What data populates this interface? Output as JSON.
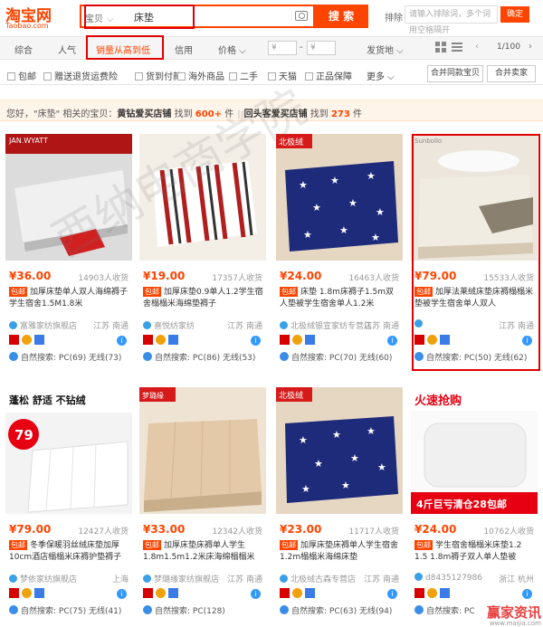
{
  "header": {
    "logo_cn": "淘宝网",
    "logo_en": "Taobao.com",
    "search_category": "宝贝",
    "search_query": "床垫",
    "search_button": "搜 索",
    "sort_label": "排除",
    "sort_placeholder": "请输入排除词，多个词用空格隔开",
    "sort_button": "确定"
  },
  "sortbar": {
    "items": [
      "综合",
      "人气",
      "销量从高到低",
      "信用",
      "价格"
    ],
    "price_from": "¥",
    "price_to": "¥",
    "ship_from": "发货地",
    "page": "1/100"
  },
  "filters": {
    "items": [
      "包邮",
      "赠送退货运费险",
      "货到付款",
      "海外商品",
      "二手",
      "天猫",
      "正品保障"
    ],
    "more": "更多",
    "merge_same": "合并同款宝贝",
    "merge_seller": "合并卖家"
  },
  "infobar": {
    "prefix": "您好，\"床垫\" 相关的宝贝：",
    "store1": "黄钻爱买店铺",
    "found1": "找到",
    "count1": "600+",
    "unit1": "件",
    "store2": "回头客爱买店铺",
    "found2": "找到",
    "count2": "273",
    "unit2": "件"
  },
  "products": [
    {
      "thumb_label": "JAN.WYATT",
      "price": "¥36.00",
      "buyers": "14903人收货",
      "title": "加厚床垫单人双人海绵褥子学生宿舍1.5M1.8米",
      "shop": "富雅家纺旗舰店",
      "loc": "江苏 南通",
      "natural": "自然搜索: PC(69) 无线(73)"
    },
    {
      "thumb_label": "",
      "price": "¥19.00",
      "buyers": "17357人收货",
      "title": "加厚床垫0.9单人1.2学生宿舍榻榻米海绵垫褥子",
      "shop": "喜悦纺家纺",
      "loc": "江苏 南通",
      "natural": "自然搜索: PC(86) 无线(53)"
    },
    {
      "thumb_label": "北极绒",
      "price": "¥24.00",
      "buyers": "16463人收货",
      "title": "床垫 1.8m床褥子1.5m双人垫被学生宿舍单人1.2米",
      "shop": "北极绒银宣家纺专营店",
      "loc": "江苏 南通",
      "natural": "自然搜索: PC(70) 无线(60)"
    },
    {
      "thumb_label": "Sunbollo",
      "price": "¥79.00",
      "buyers": "15533人收货",
      "title": "加厚法莱绒床垫床褥榻榻米垫被学生宿舍单人双人",
      "shop": "",
      "loc": "江苏 南通",
      "natural": "自然搜索: PC(50) 无线(62)"
    },
    {
      "thumb_label": "79",
      "price": "¥79.00",
      "buyers": "12427人收货",
      "title": "冬季保暖羽丝绒床垫加厚10cm酒店榻榻米床褥护垫褥子",
      "shop": "梦依家纺旗舰店",
      "loc": "上海",
      "natural": "自然搜索: PC(75) 无线(41)"
    },
    {
      "thumb_label": "梦璐缘",
      "price": "¥33.00",
      "buyers": "12342人收货",
      "title": "加厚床垫床褥单人学生1.8m1.5m1.2米床海绵榻榻米",
      "shop": "梦璐缘家纺旗舰店",
      "loc": "江苏 南通",
      "natural": "自然搜索: PC(128)"
    },
    {
      "thumb_label": "北极绒",
      "price": "¥23.00",
      "buyers": "11717人收货",
      "title": "加厚床垫床褥单人学生宿舍1.2m榻榻米海绵床垫",
      "shop": "北极绒古森专营店",
      "loc": "江苏 南通",
      "natural": "自然搜索: PC(63) 无线(94)"
    },
    {
      "thumb_label": "火速抢购",
      "price": "¥24.00",
      "buyers": "10762人收货",
      "title": "学生宿舍榻榻米床垫1.2 1.5 1.8m褥子双人单人垫被",
      "shop": "d8435127986",
      "loc": "浙江 杭州",
      "natural": "自然搜索: PC"
    }
  ],
  "watermark": "西纳电商学院",
  "corner_wm": "赢家资讯",
  "corner_wm_url": "www.maijia.com",
  "colors": {
    "accent": "#ff4400",
    "highlight_box": "#e00000",
    "link_blue": "#3a8ee6"
  }
}
